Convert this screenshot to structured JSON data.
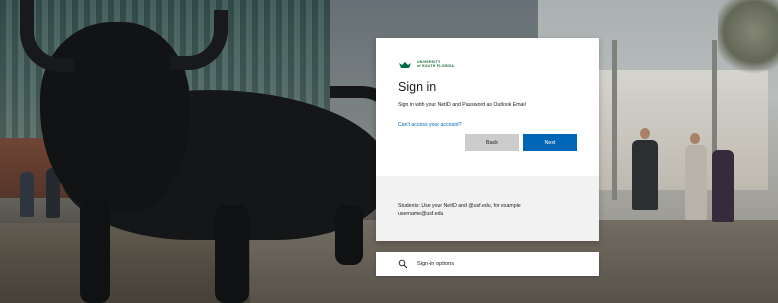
{
  "branding": {
    "logo_line1": "UNIVERSITY",
    "logo_line2": "of SOUTH FLORIDA",
    "brand_color": "#006747",
    "logo_icon": "usf-bull-logo-icon"
  },
  "signin": {
    "title": "Sign in",
    "subtitle": "Sign in with your NetID and Password as Outlook Email",
    "link_text": "Can't access your account?",
    "back_label": "Back",
    "next_label": "Next",
    "accent_color": "#0067b8"
  },
  "footer": {
    "line1": "Students: Use your NetID and @usf.edu, for example",
    "line2": "username@usf.edu"
  },
  "options": {
    "label": "Sign-in options",
    "icon": "key-search-icon"
  }
}
